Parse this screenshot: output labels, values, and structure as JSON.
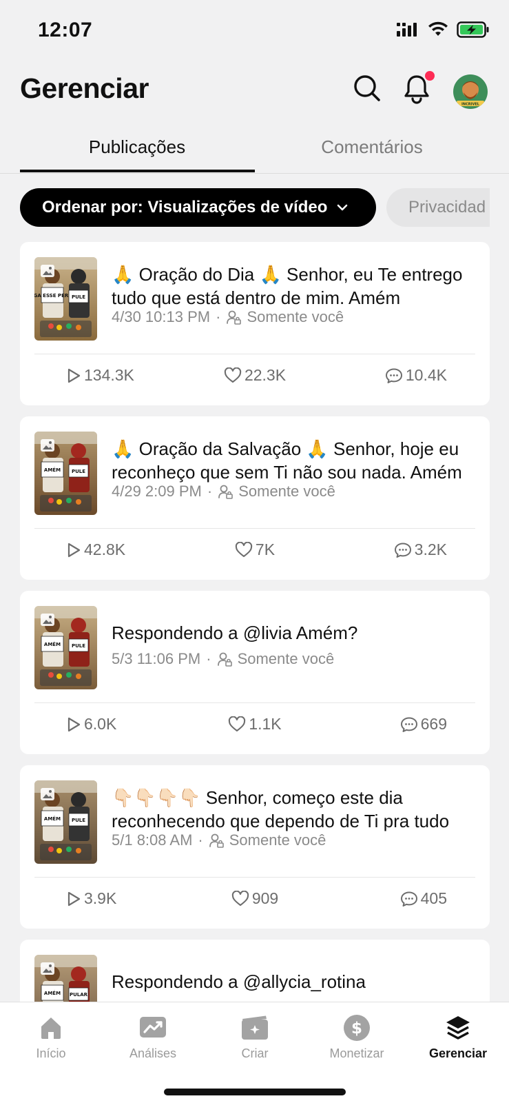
{
  "status": {
    "time": "12:07"
  },
  "header": {
    "title": "Gerenciar",
    "avatar_text": "INCRIVEL"
  },
  "tabs": [
    {
      "label": "Publicações",
      "active": true
    },
    {
      "label": "Comentários",
      "active": false
    }
  ],
  "filters": {
    "sort_label": "Ordenar por: Visualizações de vídeo",
    "privacy_label": "Privacidad"
  },
  "posts": [
    {
      "caption": "🙏 Oração do Dia 🙏 Senhor, eu Te entrego tudo que está dentro de mim. Amém",
      "date": "4/30 10:13 PM",
      "privacy": "Somente você",
      "views": "134.3K",
      "likes": "22.3K",
      "comments": "10.4K",
      "thumb_left_sign": "SIGA ESSE PERFIL",
      "thumb_right_sign": "PULE"
    },
    {
      "caption": "🙏 Oração da Salvação 🙏 Senhor, hoje eu reconheço que sem Ti não sou nada. Amém",
      "date": "4/29 2:09 PM",
      "privacy": "Somente você",
      "views": "42.8K",
      "likes": "7K",
      "comments": "3.2K",
      "thumb_left_sign": "AMÉM",
      "thumb_right_sign": "PULE"
    },
    {
      "caption": "Respondendo a @livia Amém?",
      "date": "5/3 11:06 PM",
      "privacy": "Somente você",
      "views": "6.0K",
      "likes": "1.1K",
      "comments": "669",
      "thumb_left_sign": "AMÉM",
      "thumb_right_sign": "PULE"
    },
    {
      "caption": "👇🏻👇🏻👇🏻👇🏻 Senhor, começo este dia reconhecendo que dependo de Ti pra tudo",
      "date": "5/1 8:08 AM",
      "privacy": "Somente você",
      "views": "3.9K",
      "likes": "909",
      "comments": "405",
      "thumb_left_sign": "AMÉM",
      "thumb_right_sign": "PULE"
    },
    {
      "caption": "Respondendo a @allycia_rotina",
      "thumb_left_sign": "AMÉM",
      "thumb_right_sign": "PULAR"
    }
  ],
  "tabbar": [
    {
      "label": "Início",
      "icon": "home-icon"
    },
    {
      "label": "Análises",
      "icon": "analytics-icon"
    },
    {
      "label": "Criar",
      "icon": "create-icon"
    },
    {
      "label": "Monetizar",
      "icon": "dollar-icon"
    },
    {
      "label": "Gerenciar",
      "icon": "layers-icon",
      "active": true
    }
  ],
  "colors": {
    "accent": "#fe2c55",
    "active_text": "#111111",
    "muted_text": "#8a8a8a",
    "battery": "#34c759"
  }
}
